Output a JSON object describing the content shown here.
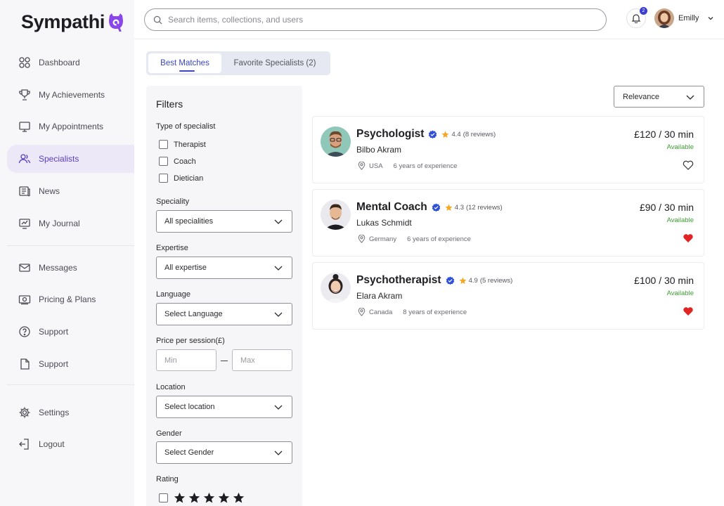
{
  "app": {
    "name": "Sympathi"
  },
  "sidebar": {
    "items": [
      {
        "label": "Dashboard"
      },
      {
        "label": "My Achievements"
      },
      {
        "label": "My Appointments"
      },
      {
        "label": "Specialists"
      },
      {
        "label": "News"
      },
      {
        "label": "My Journal"
      },
      {
        "label": "Messages"
      },
      {
        "label": "Pricing & Plans"
      },
      {
        "label": "Support"
      },
      {
        "label": "Support"
      },
      {
        "label": "Settings"
      },
      {
        "label": "Logout"
      }
    ],
    "active": "Specialists"
  },
  "search": {
    "placeholder": "Search items, collections, and users"
  },
  "header": {
    "notification_count": "2",
    "user_name": "Emilly"
  },
  "tabs": [
    {
      "label": "Best Matches"
    },
    {
      "label": "Favorite Specialists (2)"
    }
  ],
  "filters": {
    "title": "Filters",
    "type_label": "Type of specialist",
    "types": [
      "Therapist",
      "Coach",
      "Dietician"
    ],
    "speciality_label": "Speciality",
    "speciality_value": "All specialities",
    "expertise_label": "Expertise",
    "expertise_value": "All expertise",
    "language_label": "Language",
    "language_value": "Select Language",
    "price_label": "Price per session(£)",
    "price_min_placeholder": "Min",
    "price_max_placeholder": "Max",
    "location_label": "Location",
    "location_value": "Select location",
    "gender_label": "Gender",
    "gender_value": "Select Gender",
    "rating_label": "Rating",
    "rating_stars": 5
  },
  "sort": {
    "value": "Relevance"
  },
  "specialists": [
    {
      "role": "Psychologist",
      "rating": "4.4",
      "reviews": "(8 reviews)",
      "name": "Bilbo Akram",
      "country": "USA",
      "experience": "6 years of experience",
      "price": "£120 / 30 min",
      "status": "Available",
      "favorite": false
    },
    {
      "role": "Mental Coach",
      "rating": "4.3",
      "reviews": "(12 reviews)",
      "name": "Lukas Schmidt",
      "country": "Germany",
      "experience": "6 years of experience",
      "price": "£90 / 30 min",
      "status": "Available",
      "favorite": true
    },
    {
      "role": "Psychotherapist",
      "rating": "4.9",
      "reviews": "(5 reviews)",
      "name": "Elara Akram",
      "country": "Canada",
      "experience": "8 years of experience",
      "price": "£100 / 30 min",
      "status": "Available",
      "favorite": true
    }
  ],
  "colors": {
    "accent": "#3b45c4",
    "brand_purple": "#7b3fe4",
    "available": "#3f9c35",
    "favorite": "#e02424",
    "star": "#f5a623",
    "verified": "#2f4fd8"
  }
}
